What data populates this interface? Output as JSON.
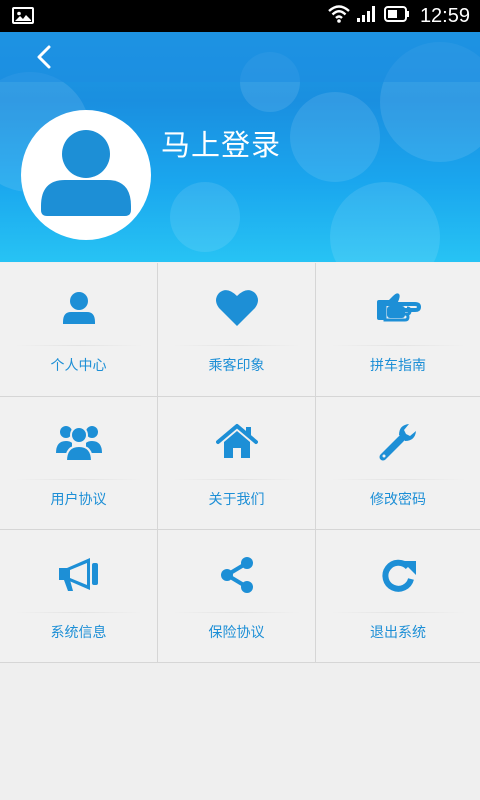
{
  "status_bar": {
    "time": "12:59",
    "icons": [
      "image-icon",
      "wifi-icon",
      "signal-icon",
      "battery-icon"
    ]
  },
  "header": {
    "back_icon": "chevron-left-icon",
    "avatar_icon": "user-avatar-icon",
    "login_text": "马上登录"
  },
  "theme": {
    "primary": "#1a9ae6",
    "icon_color": "#1d8fd6",
    "grid_bg": "#f1f1f1"
  },
  "menu": [
    {
      "label": "个人中心",
      "icon": "user-icon"
    },
    {
      "label": "乘客印象",
      "icon": "heart-icon"
    },
    {
      "label": "拼车指南",
      "icon": "pointing-hand-icon"
    },
    {
      "label": "用户协议",
      "icon": "group-icon"
    },
    {
      "label": "关于我们",
      "icon": "home-icon"
    },
    {
      "label": "修改密码",
      "icon": "wrench-icon"
    },
    {
      "label": "系统信息",
      "icon": "megaphone-icon"
    },
    {
      "label": "保险协议",
      "icon": "share-icon"
    },
    {
      "label": "退出系统",
      "icon": "refresh-icon"
    }
  ]
}
